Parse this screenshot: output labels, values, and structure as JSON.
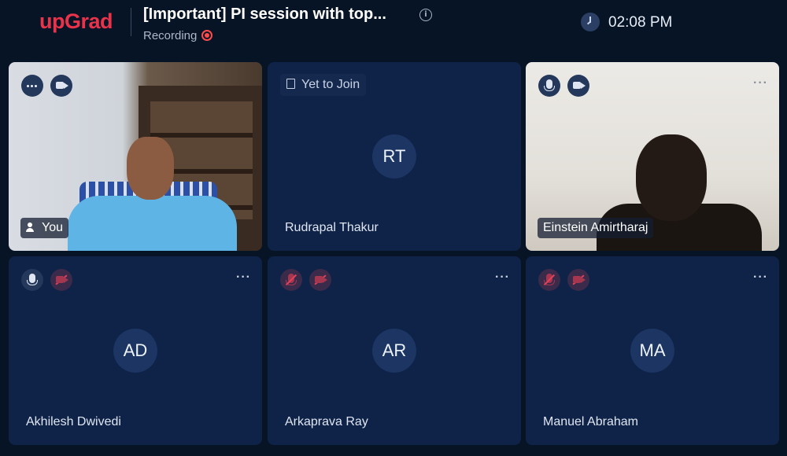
{
  "header": {
    "logo": "upGrad",
    "title": "[Important] PI session with top...",
    "recording_label": "Recording",
    "time": "02:08 PM"
  },
  "participants": [
    {
      "name": "You",
      "initials": "",
      "video": true,
      "status": ""
    },
    {
      "name": "Rudrapal Thakur",
      "initials": "RT",
      "video": false,
      "status": "Yet to Join"
    },
    {
      "name": "Einstein Amirtharaj",
      "initials": "",
      "video": true,
      "status": ""
    },
    {
      "name": "Akhilesh Dwivedi",
      "initials": "AD",
      "video": false,
      "status": ""
    },
    {
      "name": "Arkaprava Ray",
      "initials": "AR",
      "video": false,
      "status": ""
    },
    {
      "name": "Manuel Abraham",
      "initials": "MA",
      "video": false,
      "status": ""
    }
  ],
  "colors": {
    "brand": "#e8334b",
    "background": "#071426",
    "tile": "#0f2247",
    "recording": "#ff4b4b",
    "muted": "#e0405a"
  }
}
